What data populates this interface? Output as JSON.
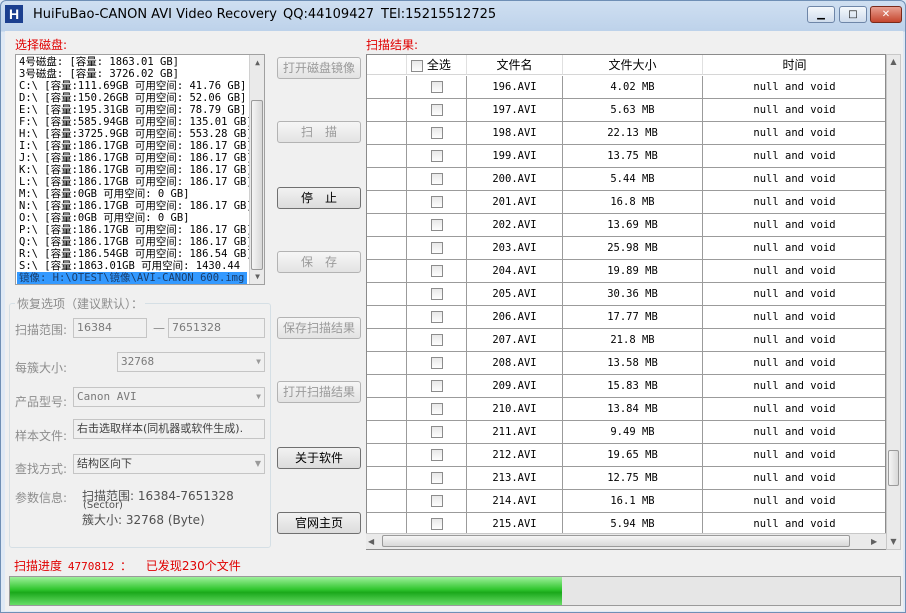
{
  "window": {
    "title": "HuiFuBao-CANON AVI Video Recovery",
    "qq": "QQ:44109427",
    "tel": "TEl:15215512725",
    "app_icon": "H",
    "icons": {
      "app": "app-logo-icon",
      "minimize": "minimize-icon",
      "maximize": "maximize-icon",
      "close": "close-icon"
    }
  },
  "disk_section": {
    "label": "选择磁盘:",
    "items": [
      "4号磁盘: [容量: 1863.01 GB]",
      "3号磁盘: [容量: 3726.02 GB]",
      "C:\\ [容量:111.69GB 可用空间: 41.76 GB]",
      "D:\\ [容量:150.26GB 可用空间: 52.06 GB]",
      "E:\\ [容量:195.31GB 可用空间: 78.79 GB]",
      "F:\\ [容量:585.94GB 可用空间: 135.01 GB]",
      "H:\\ [容量:3725.9GB 可用空间: 553.28 GB]",
      "I:\\ [容量:186.17GB 可用空间: 186.17 GB]",
      "J:\\ [容量:186.17GB 可用空间: 186.17 GB]",
      "K:\\ [容量:186.17GB 可用空间: 186.17 GB]",
      "L:\\ [容量:186.17GB 可用空间: 186.17 GB]",
      "M:\\ [容量:0GB 可用空间: 0 GB]",
      "N:\\ [容量:186.17GB 可用空间: 186.17 GB]",
      "O:\\ [容量:0GB 可用空间: 0 GB]",
      "P:\\ [容量:186.17GB 可用空间: 186.17 GB]",
      "Q:\\ [容量:186.17GB 可用空间: 186.17 GB]",
      "R:\\ [容量:186.54GB 可用空间: 186.54 GB]",
      "S:\\ [容量:1863.01GB 可用空间: 1430.44",
      "镜像: H:\\OTEST\\镜像\\AVI-CANON 600.img"
    ],
    "selected_index": 18
  },
  "buttons": {
    "open_image": "打开磁盘镜像",
    "scan": "扫　描",
    "stop": "停　止",
    "save": "保　存",
    "save_scan": "保存扫描结果",
    "open_scan": "打开扫描结果",
    "about": "关于软件",
    "website": "官网主页"
  },
  "options": {
    "group_title": "恢复选项（建议默认）：",
    "scan_range_label": "扫描范围:",
    "scan_start": "16384",
    "range_sep": "—",
    "scan_end": "7651328",
    "cluster_label": "每簇大小:",
    "cluster_value": "32768",
    "product_label": "产品型号:",
    "product_value": "Canon AVI",
    "sample_label": "样本文件:",
    "sample_value": "右击选取样本(同机器或软件生成).",
    "direction_label": "查找方式:",
    "direction_value": "结构区向下",
    "params_label": "参数信息:",
    "params_line1": "扫描范围: 16384-7651328",
    "params_line2": "(Sector)",
    "params_line3": "簇大小: 32768  (Byte)"
  },
  "results": {
    "label": "扫描结果:",
    "headers": {
      "select_all": "全选",
      "name": "文件名",
      "size": "文件大小",
      "time": "时间"
    },
    "rows": [
      {
        "name": "196.AVI",
        "size": "4.02 MB",
        "time": "null and void"
      },
      {
        "name": "197.AVI",
        "size": "5.63 MB",
        "time": "null and void"
      },
      {
        "name": "198.AVI",
        "size": "22.13 MB",
        "time": "null and void"
      },
      {
        "name": "199.AVI",
        "size": "13.75 MB",
        "time": "null and void"
      },
      {
        "name": "200.AVI",
        "size": "5.44 MB",
        "time": "null and void"
      },
      {
        "name": "201.AVI",
        "size": "16.8 MB",
        "time": "null and void"
      },
      {
        "name": "202.AVI",
        "size": "13.69 MB",
        "time": "null and void"
      },
      {
        "name": "203.AVI",
        "size": "25.98 MB",
        "time": "null and void"
      },
      {
        "name": "204.AVI",
        "size": "19.89 MB",
        "time": "null and void"
      },
      {
        "name": "205.AVI",
        "size": "30.36 MB",
        "time": "null and void"
      },
      {
        "name": "206.AVI",
        "size": "17.77 MB",
        "time": "null and void"
      },
      {
        "name": "207.AVI",
        "size": "21.8 MB",
        "time": "null and void"
      },
      {
        "name": "208.AVI",
        "size": "13.58 MB",
        "time": "null and void"
      },
      {
        "name": "209.AVI",
        "size": "15.83 MB",
        "time": "null and void"
      },
      {
        "name": "210.AVI",
        "size": "13.84 MB",
        "time": "null and void"
      },
      {
        "name": "211.AVI",
        "size": "9.49 MB",
        "time": "null and void"
      },
      {
        "name": "212.AVI",
        "size": "19.65 MB",
        "time": "null and void"
      },
      {
        "name": "213.AVI",
        "size": "12.75 MB",
        "time": "null and void"
      },
      {
        "name": "214.AVI",
        "size": "16.1 MB",
        "time": "null and void"
      },
      {
        "name": "215.AVI",
        "size": "5.94 MB",
        "time": "null and void"
      }
    ]
  },
  "status": {
    "progress_label": "扫描进度",
    "progress_value": "4770812",
    "progress_sep": "：",
    "found_text": "已发现230个文件",
    "progress_fraction": 0.62,
    "fill_color": "#2fc52d"
  }
}
